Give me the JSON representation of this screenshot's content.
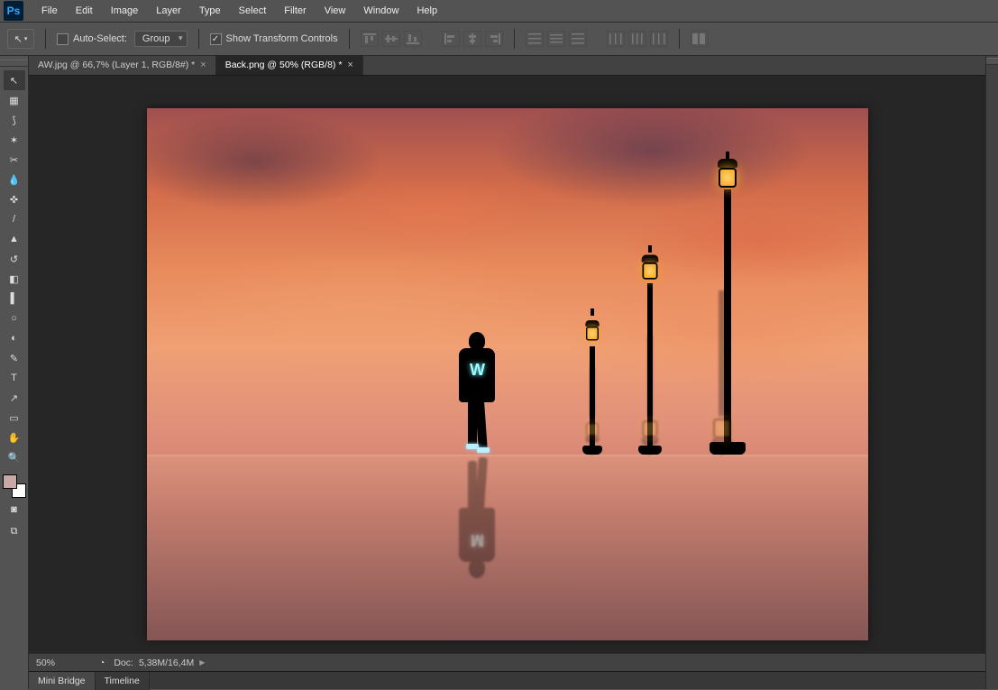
{
  "menubar": [
    "File",
    "Edit",
    "Image",
    "Layer",
    "Type",
    "Select",
    "Filter",
    "View",
    "Window",
    "Help"
  ],
  "options": {
    "auto_select_label": "Auto-Select:",
    "group_label": "Group",
    "show_transform_label": "Show Transform Controls"
  },
  "tabs": [
    {
      "label": "AW.jpg @ 66,7% (Layer 1, RGB/8#) *",
      "active": false
    },
    {
      "label": "Back.png @ 50% (RGB/8) *",
      "active": true
    }
  ],
  "tools": [
    {
      "name": "move-tool",
      "glyph": "↖"
    },
    {
      "name": "marquee-tool",
      "glyph": "▦"
    },
    {
      "name": "lasso-tool",
      "glyph": "⟆"
    },
    {
      "name": "quick-select-tool",
      "glyph": "✶"
    },
    {
      "name": "crop-tool",
      "glyph": "✂"
    },
    {
      "name": "eyedropper-tool",
      "glyph": "💧"
    },
    {
      "name": "heal-tool",
      "glyph": "✜"
    },
    {
      "name": "brush-tool",
      "glyph": "/"
    },
    {
      "name": "stamp-tool",
      "glyph": "▲"
    },
    {
      "name": "history-brush-tool",
      "glyph": "↺"
    },
    {
      "name": "eraser-tool",
      "glyph": "◧"
    },
    {
      "name": "gradient-tool",
      "glyph": "▌"
    },
    {
      "name": "blur-tool",
      "glyph": "○"
    },
    {
      "name": "dodge-tool",
      "glyph": "◐"
    },
    {
      "name": "pen-tool",
      "glyph": "✎"
    },
    {
      "name": "type-tool",
      "glyph": "T"
    },
    {
      "name": "path-select-tool",
      "glyph": "↗"
    },
    {
      "name": "shape-tool",
      "glyph": "▭"
    },
    {
      "name": "hand-tool",
      "glyph": "✋"
    },
    {
      "name": "zoom-tool",
      "glyph": "🔍"
    }
  ],
  "colors": {
    "foreground": "#c8a9a5",
    "background": "#ffffff"
  },
  "status": {
    "zoom": "50%",
    "doc_label": "Doc:",
    "doc_size": "5,38M/16,4M"
  },
  "bottom_tabs": [
    "Mini Bridge",
    "Timeline"
  ],
  "canvas": {
    "figure_logo": "W",
    "figure_logo_refl": "M"
  }
}
